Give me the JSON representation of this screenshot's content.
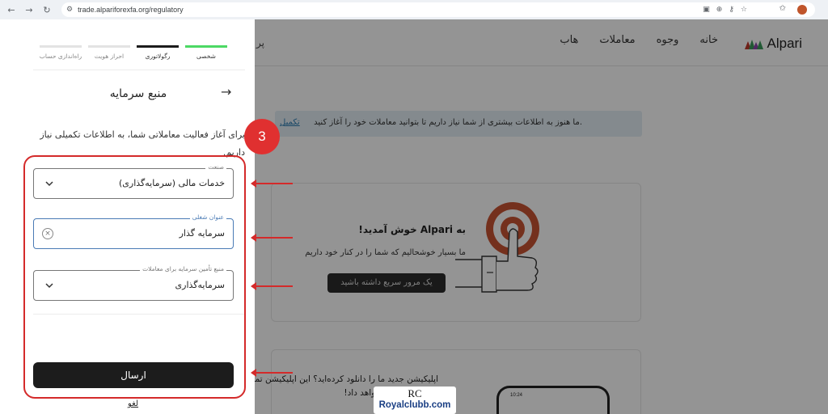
{
  "browser": {
    "url": "trade.alpariforexfa.org/regulatory"
  },
  "site": {
    "logo_text": "Alpari",
    "nav": [
      "خانه",
      "وجوه",
      "معاملات",
      "هاب"
    ],
    "partial_link": "پر"
  },
  "banner": {
    "text": "ما هنوز به اطلاعات بیشتری از شما نیاز داریم تا بتوانید معاملات خود را آغاز کنید.",
    "link": "تکمیل"
  },
  "welcome": {
    "title_prefix": "به",
    "brand": "Alpari",
    "title_suffix": "خوش آمدید!",
    "subtitle": "ما بسیار خوشحالیم که شما را در کنار خود داریم",
    "tour_button": "یک مرور سریع داشته باشید"
  },
  "app_promo": {
    "line1": "اپلیکیشن جدید ما را دانلود کرده‌اید؟ این اپلیکیشن تمام ابزاره",
    "line2": "اختیار شما قرار خواهد داد!",
    "phone_time": "10:24"
  },
  "panel": {
    "steps": [
      {
        "label": "شخصی",
        "state": "done"
      },
      {
        "label": "رگولاتوری",
        "state": "current"
      },
      {
        "label": "احراز هویت",
        "state": "pending"
      },
      {
        "label": "راه‌اندازی حساب",
        "state": "pending"
      }
    ],
    "title": "منبع سرمایه",
    "description": "برای آغاز فعالیت معاملاتی شما، به اطلاعات تکمیلی نیاز داریم.",
    "fields": {
      "industry": {
        "label": "صنعت",
        "value": "خدمات مالی (سرمایه‌گذاری)"
      },
      "job_title": {
        "label": "عنوان شغلی",
        "value": "سرمایه گذار"
      },
      "funds_source": {
        "label": "منبع تأمین سرمایه برای معاملات",
        "value": "سرمایه‌گذاری"
      }
    },
    "submit": "ارسال",
    "cancel": "لغو"
  },
  "annotation": {
    "step_number": "3",
    "color": "#d42a2a"
  },
  "watermark": {
    "mark": "RC",
    "text": "Royalclubb.com"
  },
  "colors": {
    "step_done": "#4cd964",
    "step_current": "#1c1c1c",
    "focus": "#4a7bb5",
    "brand_green": "#3a9a5a",
    "brand_red": "#c0392b"
  }
}
